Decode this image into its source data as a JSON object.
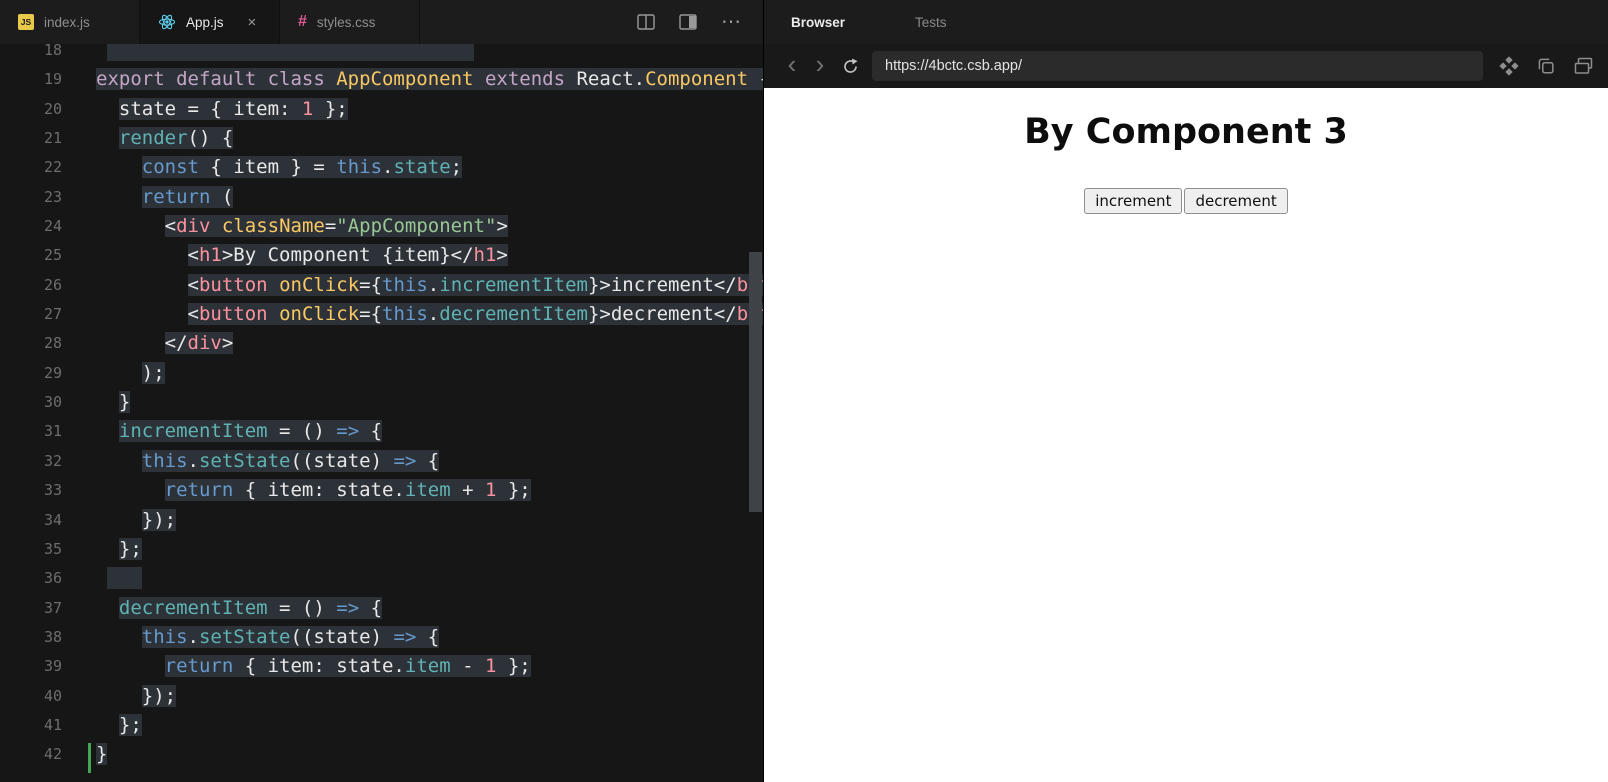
{
  "colors": {
    "editor_bg": "#161616",
    "selection_bg": "#2d3239",
    "preview_bg": "#ffffff",
    "js_icon": "#e8c94a",
    "react_icon": "#5ecbe8",
    "css_icon": "#dd5f96",
    "git_added": "#43a657",
    "syn_text": "#e8e8e8",
    "syn_keyword": "#c5a5c5",
    "syn_keyword2": "#6699cc",
    "syn_class": "#fac863",
    "syn_function": "#5fb3b3",
    "syn_tag": "#fc929e",
    "syn_attr": "#fac863",
    "syn_string": "#99c794",
    "syn_number": "#fc929e"
  },
  "icons": {
    "js_badge": "JS",
    "css_hash": "#",
    "close": "×",
    "more": "⋯",
    "back": "‹",
    "forward": "›"
  },
  "editor": {
    "tabs": [
      {
        "label": "index.js"
      },
      {
        "label": "App.js"
      },
      {
        "label": "styles.css"
      }
    ],
    "lines": [
      {
        "num": 18,
        "indent": 1,
        "tokens": [
          [
            "pl",
            "                                "
          ]
        ]
      },
      {
        "num": 19,
        "indent": 0,
        "tokens": [
          [
            "kw1",
            "export default class "
          ],
          [
            "cls",
            "AppComponent"
          ],
          [
            "kw1",
            " extends "
          ],
          [
            "pl",
            "React."
          ],
          [
            "cls",
            "Component"
          ],
          [
            "pl",
            " {"
          ]
        ]
      },
      {
        "num": 20,
        "indent": 2,
        "tokens": [
          [
            "pl",
            "state = { item: "
          ],
          [
            "num",
            "1"
          ],
          [
            "pl",
            " };"
          ]
        ]
      },
      {
        "num": 21,
        "indent": 2,
        "tokens": [
          [
            "fn",
            "render"
          ],
          [
            "pl",
            "() {"
          ]
        ]
      },
      {
        "num": 22,
        "indent": 4,
        "tokens": [
          [
            "kw2",
            "const"
          ],
          [
            "pl",
            " { item } = "
          ],
          [
            "kw2",
            "this"
          ],
          [
            "pl",
            "."
          ],
          [
            "fn",
            "state"
          ],
          [
            "pl",
            ";"
          ]
        ]
      },
      {
        "num": 23,
        "indent": 4,
        "tokens": [
          [
            "kw2",
            "return"
          ],
          [
            "pl",
            " ("
          ]
        ]
      },
      {
        "num": 24,
        "indent": 6,
        "tokens": [
          [
            "pl",
            "<"
          ],
          [
            "tag",
            "div"
          ],
          [
            "pl",
            " "
          ],
          [
            "attr",
            "className"
          ],
          [
            "pl",
            "="
          ],
          [
            "str",
            "\"AppComponent\""
          ],
          [
            "pl",
            ">"
          ]
        ]
      },
      {
        "num": 25,
        "indent": 8,
        "tokens": [
          [
            "pl",
            "<"
          ],
          [
            "tag",
            "h1"
          ],
          [
            "pl",
            ">By Component {item}</"
          ],
          [
            "tag",
            "h1"
          ],
          [
            "pl",
            ">"
          ]
        ]
      },
      {
        "num": 26,
        "indent": 8,
        "tokens": [
          [
            "pl",
            "<"
          ],
          [
            "tag",
            "button"
          ],
          [
            "pl",
            " "
          ],
          [
            "attr",
            "onClick"
          ],
          [
            "pl",
            "={"
          ],
          [
            "kw2",
            "this"
          ],
          [
            "pl",
            "."
          ],
          [
            "fn",
            "incrementItem"
          ],
          [
            "pl",
            "}>increment</"
          ],
          [
            "tag",
            "button"
          ],
          [
            "pl",
            ">"
          ]
        ]
      },
      {
        "num": 27,
        "indent": 8,
        "tokens": [
          [
            "pl",
            "<"
          ],
          [
            "tag",
            "button"
          ],
          [
            "pl",
            " "
          ],
          [
            "attr",
            "onClick"
          ],
          [
            "pl",
            "={"
          ],
          [
            "kw2",
            "this"
          ],
          [
            "pl",
            "."
          ],
          [
            "fn",
            "decrementItem"
          ],
          [
            "pl",
            "}>decrement</"
          ],
          [
            "tag",
            "button"
          ],
          [
            "pl",
            ">"
          ]
        ]
      },
      {
        "num": 28,
        "indent": 6,
        "tokens": [
          [
            "pl",
            "</"
          ],
          [
            "tag",
            "div"
          ],
          [
            "pl",
            ">"
          ]
        ]
      },
      {
        "num": 29,
        "indent": 4,
        "tokens": [
          [
            "pl",
            ");"
          ]
        ]
      },
      {
        "num": 30,
        "indent": 2,
        "tokens": [
          [
            "pl",
            "}"
          ]
        ]
      },
      {
        "num": 31,
        "indent": 2,
        "tokens": [
          [
            "fn",
            "incrementItem"
          ],
          [
            "pl",
            " = () "
          ],
          [
            "kw2",
            "=>"
          ],
          [
            "pl",
            " {"
          ]
        ]
      },
      {
        "num": 32,
        "indent": 4,
        "tokens": [
          [
            "kw2",
            "this"
          ],
          [
            "pl",
            "."
          ],
          [
            "fn",
            "setState"
          ],
          [
            "pl",
            "((state) "
          ],
          [
            "kw2",
            "=>"
          ],
          [
            "pl",
            " {"
          ]
        ]
      },
      {
        "num": 33,
        "indent": 6,
        "tokens": [
          [
            "kw2",
            "return"
          ],
          [
            "pl",
            " { item: state."
          ],
          [
            "fn",
            "item"
          ],
          [
            "pl",
            " + "
          ],
          [
            "num",
            "1"
          ],
          [
            "pl",
            " };"
          ]
        ]
      },
      {
        "num": 34,
        "indent": 4,
        "tokens": [
          [
            "pl",
            "});"
          ]
        ]
      },
      {
        "num": 35,
        "indent": 2,
        "tokens": [
          [
            "pl",
            "};"
          ]
        ]
      },
      {
        "num": 36,
        "indent": 1,
        "tokens": [
          [
            "pl",
            "   "
          ]
        ]
      },
      {
        "num": 37,
        "indent": 2,
        "tokens": [
          [
            "fn",
            "decrementItem"
          ],
          [
            "pl",
            " = () "
          ],
          [
            "kw2",
            "=>"
          ],
          [
            "pl",
            " {"
          ]
        ]
      },
      {
        "num": 38,
        "indent": 4,
        "tokens": [
          [
            "kw2",
            "this"
          ],
          [
            "pl",
            "."
          ],
          [
            "fn",
            "setState"
          ],
          [
            "pl",
            "((state) "
          ],
          [
            "kw2",
            "=>"
          ],
          [
            "pl",
            " {"
          ]
        ]
      },
      {
        "num": 39,
        "indent": 6,
        "tokens": [
          [
            "kw2",
            "return"
          ],
          [
            "pl",
            " { item: state."
          ],
          [
            "fn",
            "item"
          ],
          [
            "pl",
            " - "
          ],
          [
            "num",
            "1"
          ],
          [
            "pl",
            " };"
          ]
        ]
      },
      {
        "num": 40,
        "indent": 4,
        "tokens": [
          [
            "pl",
            "});"
          ]
        ]
      },
      {
        "num": 41,
        "indent": 2,
        "tokens": [
          [
            "pl",
            "};"
          ]
        ]
      },
      {
        "num": 42,
        "indent": 0,
        "tokens": [
          [
            "pl",
            "}"
          ]
        ],
        "git": true
      }
    ]
  },
  "browser": {
    "tabs": [
      {
        "label": "Browser"
      },
      {
        "label": "Tests"
      }
    ],
    "url": "https://4bctc.csb.app/",
    "preview": {
      "heading": "By Component 3",
      "buttons": [
        "increment",
        "decrement"
      ]
    }
  }
}
